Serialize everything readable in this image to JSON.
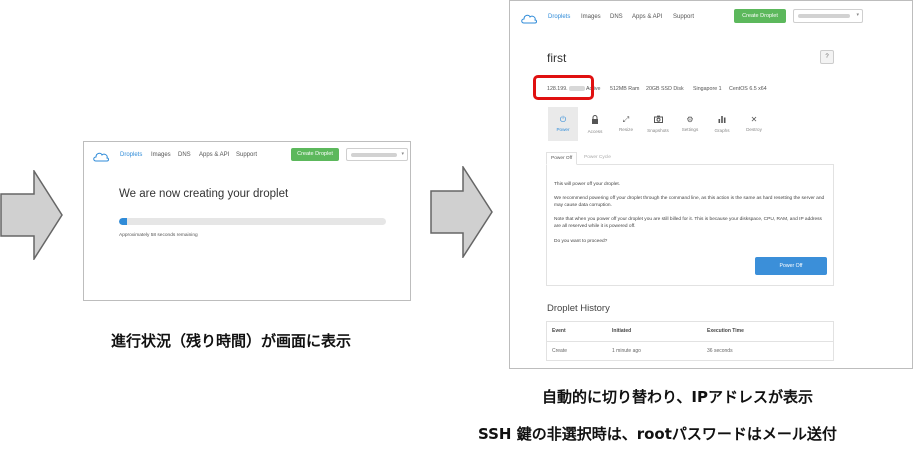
{
  "colors": {
    "accent": "#2f8bd8",
    "create_button": "#5cb85c",
    "highlight": "#e01010",
    "arrow_fill": "#d0d0d0",
    "arrow_stroke": "#666666"
  },
  "nav": {
    "droplets": "Droplets",
    "images": "Images",
    "dns": "DNS",
    "apps_api": "Apps & API",
    "support": "Support",
    "create_droplet": "Create Droplet",
    "user_caret": "▾"
  },
  "creating": {
    "title": "We are now creating your droplet",
    "progress_fraction": 0.03,
    "remaining": "Approximately 58 seconds remaining"
  },
  "droplet": {
    "name": "first",
    "help": "?",
    "ip_prefix": "128.199.",
    "status": "Active",
    "ram": "512MB Ram",
    "disk": "20GB SSD Disk",
    "region": "Singapore 1",
    "os": "CentOS 6.5 x64",
    "tools": [
      {
        "label": "Power",
        "icon": "power-icon"
      },
      {
        "label": "Access",
        "icon": "lock-icon"
      },
      {
        "label": "Resize",
        "icon": "resize-icon"
      },
      {
        "label": "Snapshots",
        "icon": "camera-icon"
      },
      {
        "label": "Settings",
        "icon": "gear-icon"
      },
      {
        "label": "Graphs",
        "icon": "bar-chart-icon"
      },
      {
        "label": "Destroy",
        "icon": "close-icon"
      }
    ],
    "tabs": {
      "power_off": "Power Off",
      "power_cycle": "Power Cycle"
    },
    "panel": {
      "line1": "This will power off your droplet.",
      "line2": "We recommend powering off your droplet through the command line, as this action is the same as hard resetting the server and may cause data corruption.",
      "line3": "Note that when you power off your droplet you are still billed for it. This is because your diskspace, CPU, RAM, and IP address are all reserved while it is powered off.",
      "line4": "Do you want to proceed?",
      "button": "Power Off"
    },
    "history": {
      "title": "Droplet History",
      "headers": [
        "Event",
        "Initiated",
        "Execution Time"
      ],
      "rows": [
        [
          "Create",
          "1 minute ago",
          "36 seconds"
        ]
      ]
    }
  },
  "captions": {
    "left": "進行状況（残り時間）が画面に表示",
    "right1": "自動的に切り替わり、IPアドレスが表示",
    "right2": "SSH 鍵の非選択時は、rootパスワードはメール送付"
  }
}
